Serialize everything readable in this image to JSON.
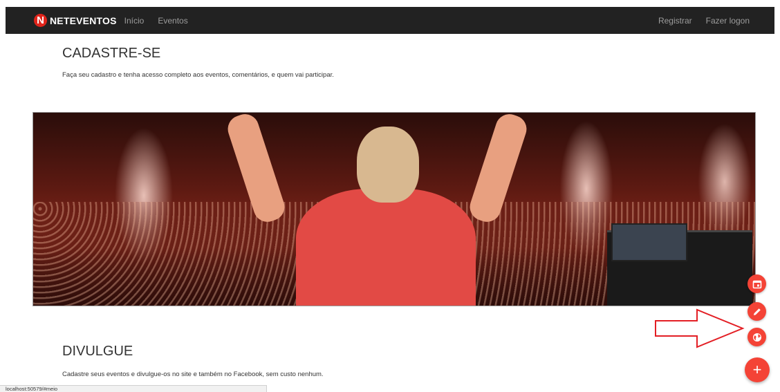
{
  "navbar": {
    "logo_letter": "N",
    "brand": "NETEVENTOS",
    "links_left": [
      {
        "label": "Início"
      },
      {
        "label": "Eventos"
      }
    ],
    "links_right": [
      {
        "label": "Registrar"
      },
      {
        "label": "Fazer logon"
      }
    ]
  },
  "sections": {
    "signup": {
      "title": "CADASTRE-SE",
      "text": "Faça seu cadastro e tenha acesso completo aos eventos, comentários, e quem vai participar."
    },
    "promote": {
      "title": "DIVULGUE",
      "text": "Cadastre seus eventos e divulgue-os no site e também no Facebook, sem custo nenhum."
    }
  },
  "fab": {
    "main_icon": "plus-icon",
    "main_symbol": "+",
    "actions": [
      {
        "icon": "calendar-icon"
      },
      {
        "icon": "pencil-icon"
      },
      {
        "icon": "globe-icon"
      }
    ],
    "color": "#f44336"
  },
  "annotation": {
    "color": "#e31e24"
  },
  "status_bar": {
    "url": "localhost:50579/#meio"
  },
  "colors": {
    "navbar_bg": "#222222",
    "brand_red": "#e0241b",
    "nav_link": "#9d9d9d"
  }
}
